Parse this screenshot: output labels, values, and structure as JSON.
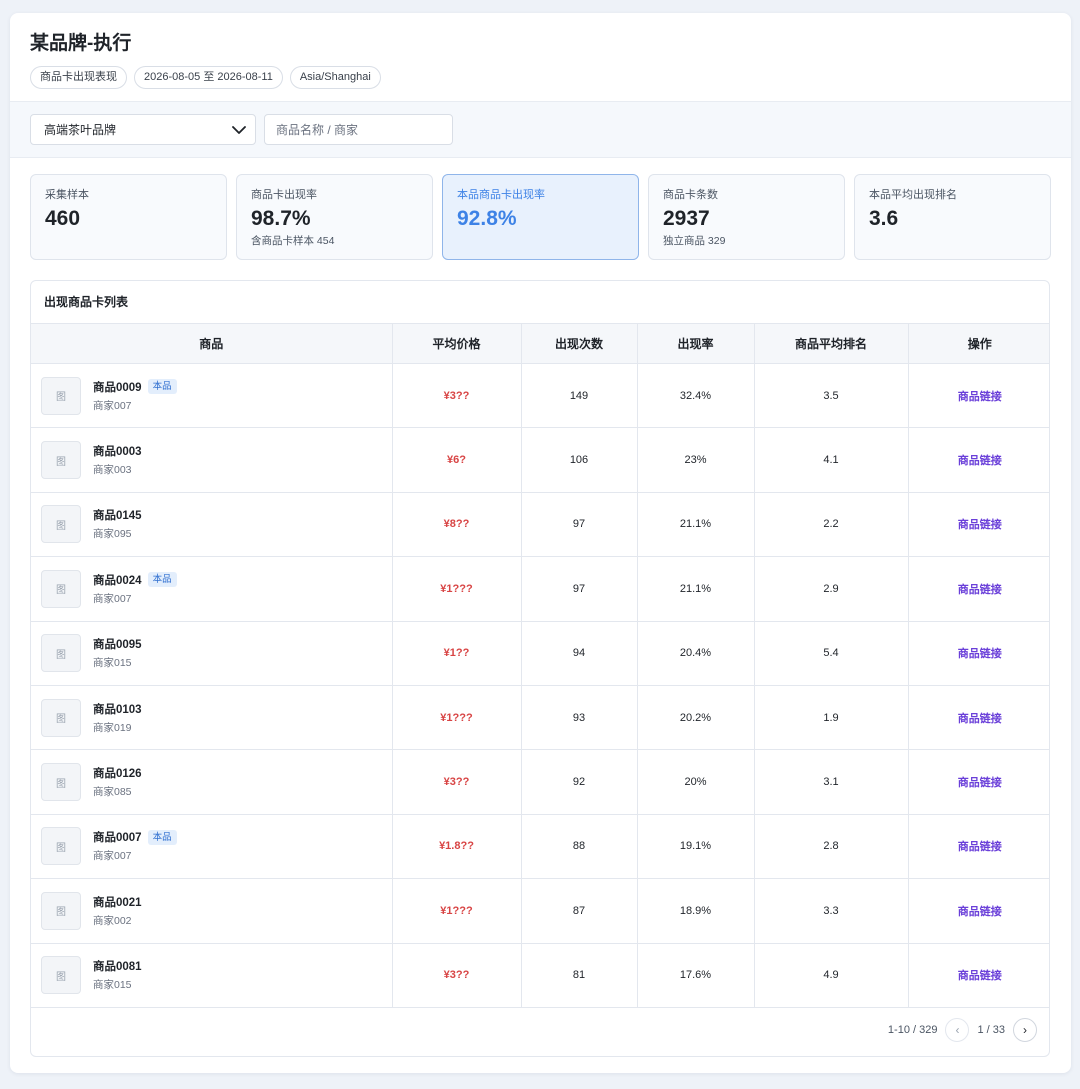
{
  "header": {
    "title": "某品牌-执行",
    "chips": [
      "商品卡出现表现",
      "2026-08-05 至 2026-08-11",
      "Asia/Shanghai"
    ]
  },
  "filters": {
    "category_select": "高端茶叶品牌",
    "search_placeholder": "商品名称 / 商家"
  },
  "stats": [
    {
      "label": "采集样本",
      "value": "460",
      "sub": ""
    },
    {
      "label": "商品卡出现率",
      "value": "98.7%",
      "sub": "含商品卡样本 454"
    },
    {
      "label": "本品商品卡出现率",
      "value": "92.8%",
      "sub": ""
    },
    {
      "label": "商品卡条数",
      "value": "2937",
      "sub": "独立商品 329"
    },
    {
      "label": "本品平均出现排名",
      "value": "3.6",
      "sub": ""
    }
  ],
  "table": {
    "title": "出现商品卡列表",
    "columns": [
      "商品",
      "平均价格",
      "出现次数",
      "出现率",
      "商品平均排名",
      "操作"
    ],
    "thumb_text": "图",
    "own_tag": "本品",
    "link_label": "商品链接",
    "rows": [
      {
        "name": "商品0009",
        "merchant": "商家007",
        "own": true,
        "price": "¥3??",
        "count": "149",
        "rate": "32.4%",
        "rank": "3.5"
      },
      {
        "name": "商品0003",
        "merchant": "商家003",
        "own": false,
        "price": "¥6?",
        "count": "106",
        "rate": "23%",
        "rank": "4.1"
      },
      {
        "name": "商品0145",
        "merchant": "商家095",
        "own": false,
        "price": "¥8??",
        "count": "97",
        "rate": "21.1%",
        "rank": "2.2"
      },
      {
        "name": "商品0024",
        "merchant": "商家007",
        "own": true,
        "price": "¥1???",
        "count": "97",
        "rate": "21.1%",
        "rank": "2.9"
      },
      {
        "name": "商品0095",
        "merchant": "商家015",
        "own": false,
        "price": "¥1??",
        "count": "94",
        "rate": "20.4%",
        "rank": "5.4"
      },
      {
        "name": "商品0103",
        "merchant": "商家019",
        "own": false,
        "price": "¥1???",
        "count": "93",
        "rate": "20.2%",
        "rank": "1.9"
      },
      {
        "name": "商品0126",
        "merchant": "商家085",
        "own": false,
        "price": "¥3??",
        "count": "92",
        "rate": "20%",
        "rank": "3.1"
      },
      {
        "name": "商品0007",
        "merchant": "商家007",
        "own": true,
        "price": "¥1.8??",
        "count": "88",
        "rate": "19.1%",
        "rank": "2.8"
      },
      {
        "name": "商品0021",
        "merchant": "商家002",
        "own": false,
        "price": "¥1???",
        "count": "87",
        "rate": "18.9%",
        "rank": "3.3"
      },
      {
        "name": "商品0081",
        "merchant": "商家015",
        "own": false,
        "price": "¥3??",
        "count": "81",
        "rate": "17.6%",
        "rank": "4.9"
      }
    ]
  },
  "pagination": {
    "range": "1-10 / 329",
    "prev_icon": "‹",
    "page": "1 / 33",
    "next_icon": "›"
  },
  "colors": {
    "accent": "#3d82e6",
    "price": "#d84444",
    "link": "#6a3fd9"
  }
}
